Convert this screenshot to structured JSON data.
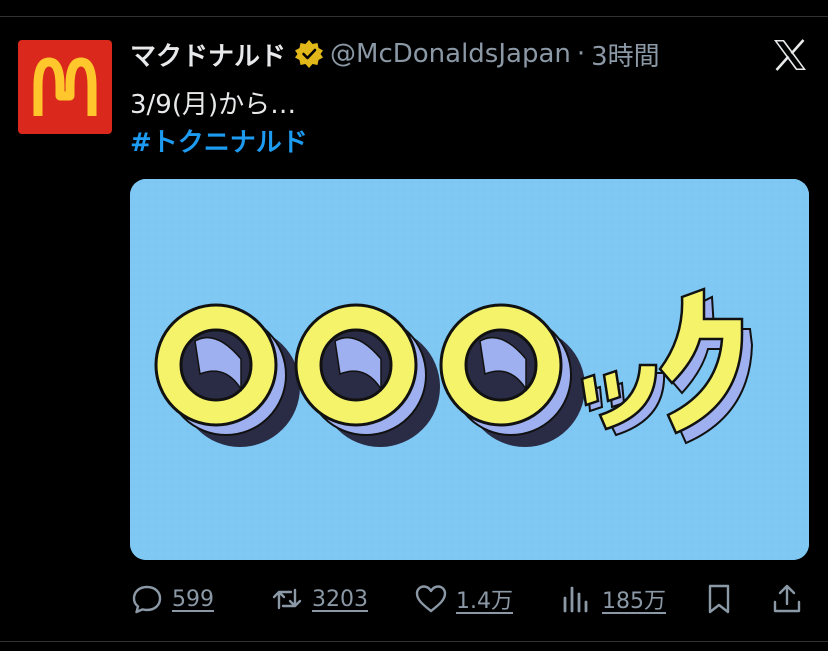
{
  "tweet": {
    "display_name": "マクドナルド",
    "handle": "@McDonaldsJapan",
    "separator": "·",
    "time": "3時間",
    "text_line1": "3/9(月)から…",
    "hashtag": "#トクニナルド"
  },
  "media": {
    "caption_text": "○○○ック"
  },
  "actions": {
    "replies": "599",
    "retweets": "3203",
    "likes": "1.4万",
    "views": "185万"
  },
  "colors": {
    "brand_red": "#da291c",
    "brand_yellow": "#ffc72c",
    "link_blue": "#1d9bf0",
    "media_bg": "#7fc8f4"
  },
  "icons": [
    "mcdonalds-logo-icon",
    "verified-badge-icon",
    "x-logo-icon",
    "reply-icon",
    "retweet-icon",
    "like-icon",
    "views-icon",
    "bookmark-icon",
    "share-icon"
  ]
}
